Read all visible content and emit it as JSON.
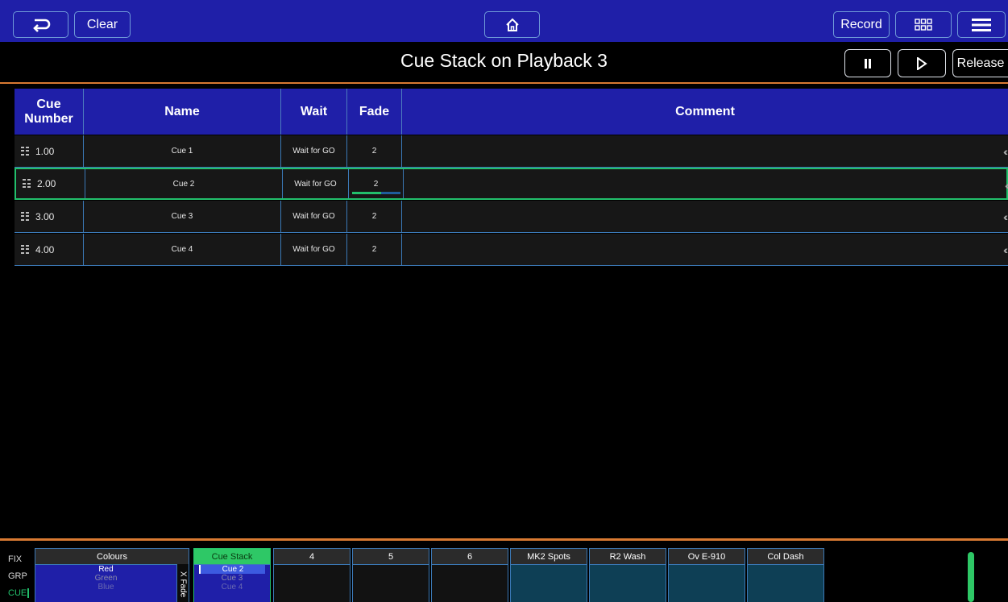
{
  "toolbar": {
    "back_icon": "back-arrow-icon",
    "clear_label": "Clear",
    "home_icon": "home-icon",
    "record_label": "Record",
    "grid_icon": "grid-view-icon",
    "menu_icon": "hamburger-menu-icon"
  },
  "titlebar": {
    "title": "Cue Stack on Playback 3",
    "pause_icon": "pause-icon",
    "play_icon": "play-icon",
    "release_label": "Release"
  },
  "table": {
    "headers": {
      "cue_number": "Cue Number",
      "name": "Name",
      "wait": "Wait",
      "fade": "Fade",
      "comment": "Comment"
    },
    "rows": [
      {
        "number": "1.00",
        "name": "Cue 1",
        "wait": "Wait for GO",
        "fade": "2",
        "comment": "",
        "active": false
      },
      {
        "number": "2.00",
        "name": "Cue 2",
        "wait": "Wait for GO",
        "fade": "2",
        "comment": "",
        "active": true,
        "fade_progress": 0.6
      },
      {
        "number": "3.00",
        "name": "Cue 3",
        "wait": "Wait for GO",
        "fade": "2",
        "comment": "",
        "active": false
      },
      {
        "number": "4.00",
        "name": "Cue 4",
        "wait": "Wait for GO",
        "fade": "2",
        "comment": "",
        "active": false
      }
    ]
  },
  "bottom": {
    "side_labels": [
      "FIX",
      "GRP",
      "CUE"
    ],
    "playbacks": [
      {
        "title": "Colours",
        "items": [
          "Red",
          "Green",
          "Blue"
        ]
      },
      {
        "title": "Cue Stack",
        "items": [
          "Cue 2",
          "Cue 3",
          "Cue 4"
        ],
        "side_label": "X Fade"
      },
      {
        "title": "4",
        "items": []
      },
      {
        "title": "5",
        "items": []
      },
      {
        "title": "6",
        "items": []
      },
      {
        "title": "MK2 Spots",
        "items": []
      },
      {
        "title": "R2 Wash",
        "items": []
      },
      {
        "title": "Ov E-910",
        "items": []
      },
      {
        "title": "Col Dash",
        "items": []
      }
    ]
  },
  "colors": {
    "toolbar_bg": "#1f1fa8",
    "accent_orange": "#d97a32",
    "active_green": "#22c06c",
    "teal": "#0e3f55"
  }
}
